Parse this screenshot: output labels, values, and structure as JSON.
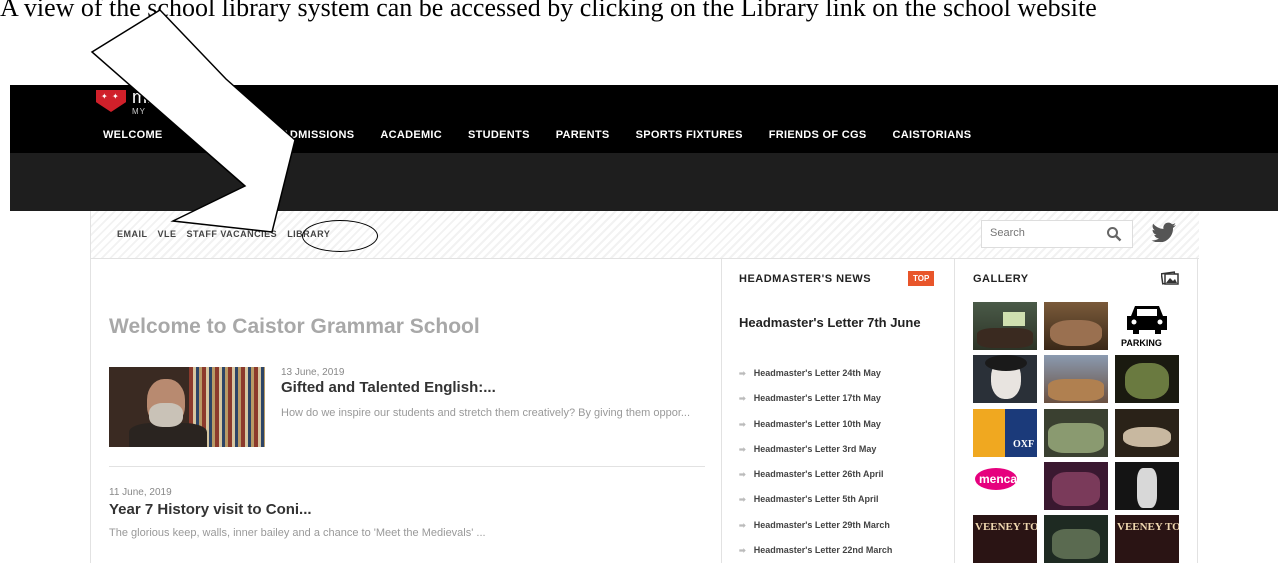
{
  "caption": "A view of the school library system can be accessed by clicking on the Library link on the school website",
  "site": {
    "name": "mmar School",
    "sub_name": "MY",
    "nav": [
      "WELCOME",
      "ON",
      "ADMISSIONS",
      "ACADEMIC",
      "STUDENTS",
      "PARENTS",
      "SPORTS FIXTURES",
      "FRIENDS OF CGS",
      "CAISTORIANS"
    ]
  },
  "utility": {
    "links": [
      "EMAIL",
      "VLE",
      "STAFF VACANCIES",
      "LIBRARY"
    ],
    "search_placeholder": "Search"
  },
  "main": {
    "welcome_title": "Welcome to Caistor Grammar School",
    "articles": [
      {
        "date": "13 June, 2019",
        "title": "Gifted and Talented English:...",
        "excerpt": "How do we inspire our students and stretch them creatively? By giving them oppor..."
      },
      {
        "date": "11 June, 2019",
        "title": "Year 7 History visit to Coni...",
        "excerpt": "The glorious keep, walls, inner bailey and a chance to 'Meet the Medievals' ..."
      }
    ]
  },
  "news": {
    "heading": "HEADMASTER'S NEWS",
    "badge": "TOP",
    "featured": "Headmaster's Letter 7th June",
    "items": [
      "Headmaster's Letter 24th May",
      "Headmaster's Letter 17th May",
      "Headmaster's Letter 10th May",
      "Headmaster's Letter 3rd May",
      "Headmaster's Letter 26th April",
      "Headmaster's Letter 5th April",
      "Headmaster's Letter 29th March",
      "Headmaster's Letter 22nd March"
    ]
  },
  "gallery": {
    "heading": "GALLERY",
    "parking_label": "PARKING",
    "mencap_label": "mencap",
    "oxford_label": "OXF",
    "sweeney_label": "VEENEY TO"
  },
  "colors": {
    "top_bar": "#000000",
    "dark_band": "#1e1e1e",
    "accent_badge": "#e8552a",
    "logo_red": "#d0202a"
  }
}
